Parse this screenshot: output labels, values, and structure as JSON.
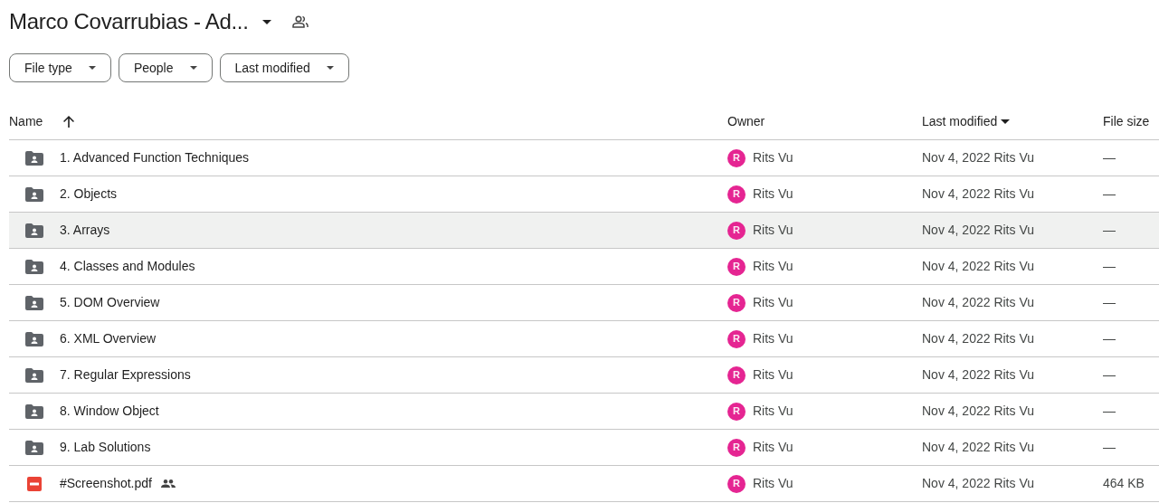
{
  "title": "Marco Covarrubias - Ad...",
  "filters": [
    "File type",
    "People",
    "Last modified"
  ],
  "columns": [
    {
      "label": "Name",
      "sort_arrow": true,
      "sort_caret": false
    },
    {
      "label": "Owner",
      "sort_arrow": false,
      "sort_caret": false
    },
    {
      "label": "Last modified",
      "sort_arrow": false,
      "sort_caret": true
    },
    {
      "label": "File size",
      "sort_arrow": false,
      "sort_caret": false
    }
  ],
  "rows": [
    {
      "kind": "folder",
      "name": "1. Advanced Function Techniques",
      "owner_initial": "R",
      "owner": "Rits Vu",
      "modified": "Nov 4, 2022 Rits Vu",
      "size": "—",
      "selected": false,
      "shared": false
    },
    {
      "kind": "folder",
      "name": "2. Objects",
      "owner_initial": "R",
      "owner": "Rits Vu",
      "modified": "Nov 4, 2022 Rits Vu",
      "size": "—",
      "selected": false,
      "shared": false
    },
    {
      "kind": "folder",
      "name": "3. Arrays",
      "owner_initial": "R",
      "owner": "Rits Vu",
      "modified": "Nov 4, 2022 Rits Vu",
      "size": "—",
      "selected": true,
      "shared": false
    },
    {
      "kind": "folder",
      "name": "4. Classes and Modules",
      "owner_initial": "R",
      "owner": "Rits Vu",
      "modified": "Nov 4, 2022 Rits Vu",
      "size": "—",
      "selected": false,
      "shared": false
    },
    {
      "kind": "folder",
      "name": "5. DOM Overview",
      "owner_initial": "R",
      "owner": "Rits Vu",
      "modified": "Nov 4, 2022 Rits Vu",
      "size": "—",
      "selected": false,
      "shared": false
    },
    {
      "kind": "folder",
      "name": "6. XML Overview",
      "owner_initial": "R",
      "owner": "Rits Vu",
      "modified": "Nov 4, 2022 Rits Vu",
      "size": "—",
      "selected": false,
      "shared": false
    },
    {
      "kind": "folder",
      "name": "7. Regular Expressions",
      "owner_initial": "R",
      "owner": "Rits Vu",
      "modified": "Nov 4, 2022 Rits Vu",
      "size": "—",
      "selected": false,
      "shared": false
    },
    {
      "kind": "folder",
      "name": "8. Window Object",
      "owner_initial": "R",
      "owner": "Rits Vu",
      "modified": "Nov 4, 2022 Rits Vu",
      "size": "—",
      "selected": false,
      "shared": false
    },
    {
      "kind": "folder",
      "name": "9. Lab Solutions",
      "owner_initial": "R",
      "owner": "Rits Vu",
      "modified": "Nov 4, 2022 Rits Vu",
      "size": "—",
      "selected": false,
      "shared": false
    },
    {
      "kind": "pdf",
      "name": "#Screenshot.pdf",
      "owner_initial": "R",
      "owner": "Rits Vu",
      "modified": "Nov 4, 2022 Rits Vu",
      "size": "464 KB",
      "selected": false,
      "shared": true
    }
  ]
}
